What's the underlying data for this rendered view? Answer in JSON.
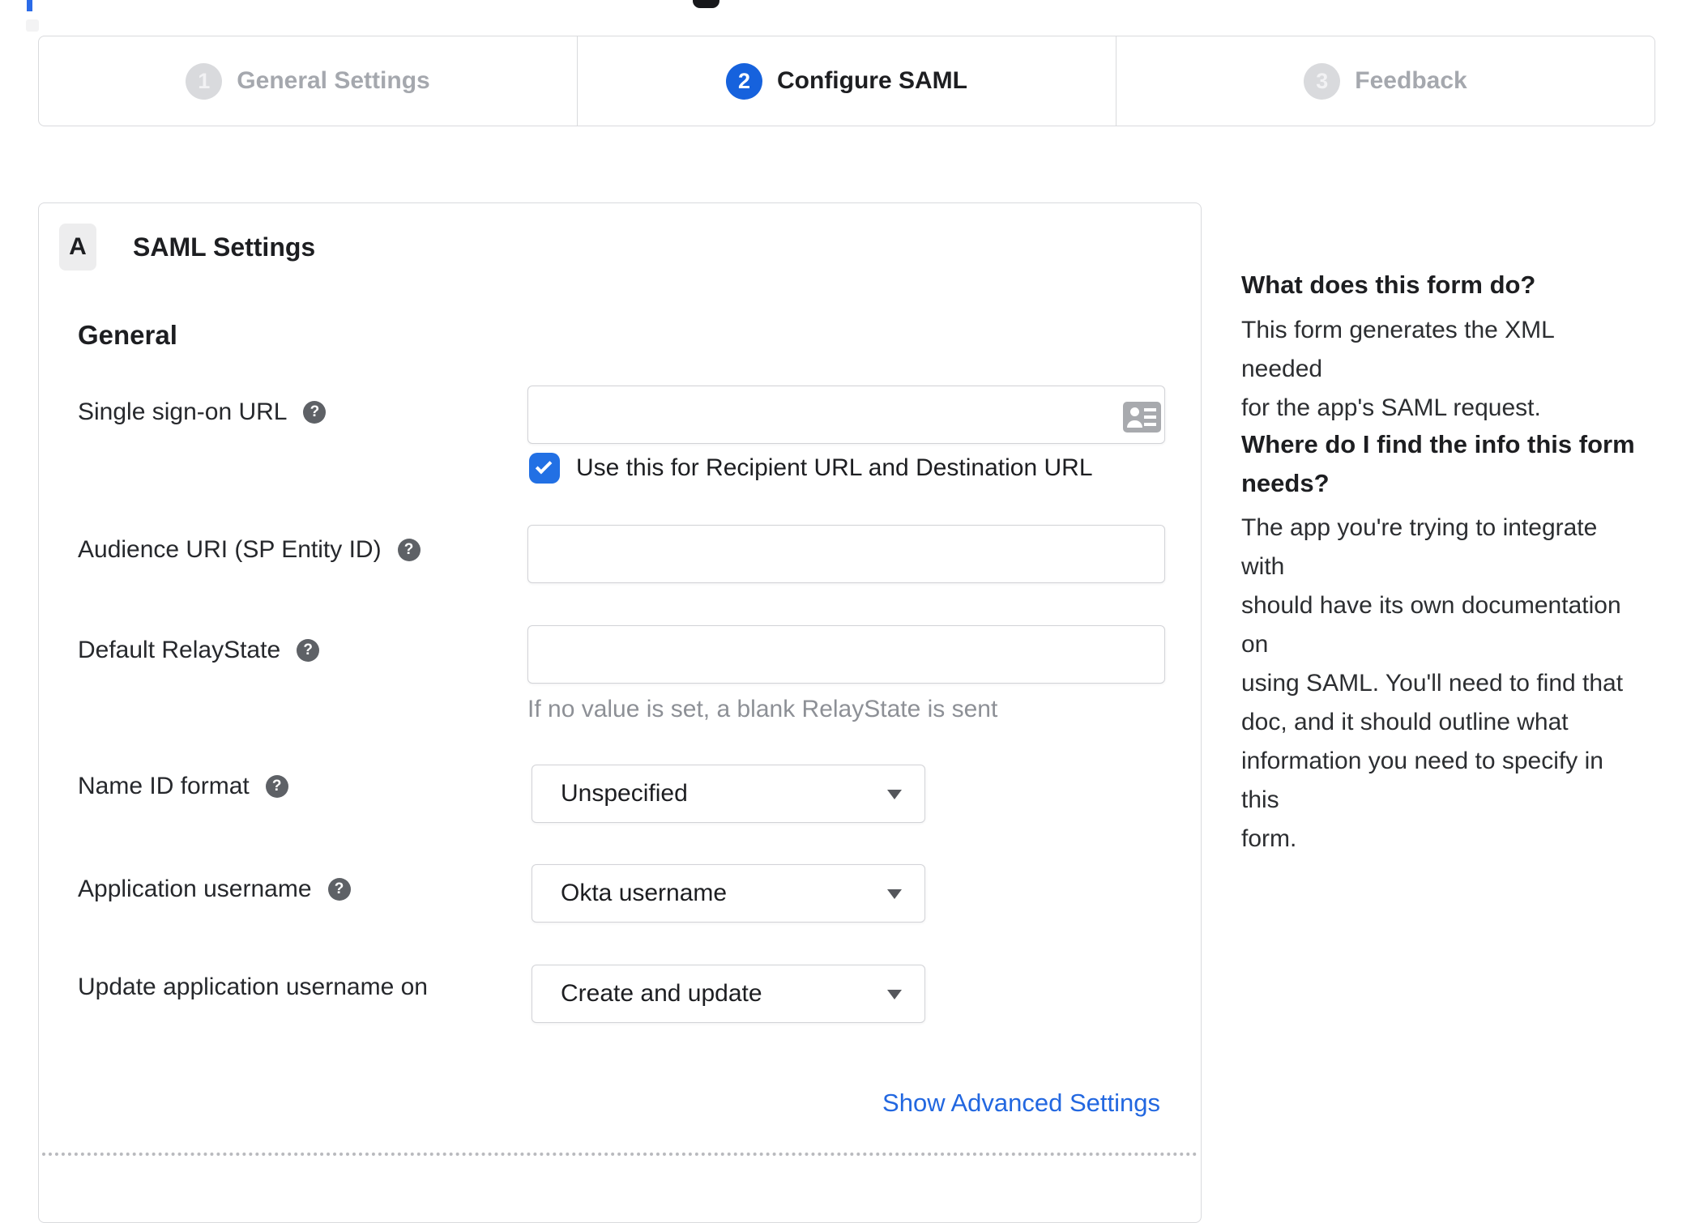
{
  "stepper": {
    "steps": [
      {
        "number": "1",
        "label": "General Settings",
        "state": "inactive"
      },
      {
        "number": "2",
        "label": "Configure SAML",
        "state": "active"
      },
      {
        "number": "3",
        "label": "Feedback",
        "state": "inactive"
      }
    ]
  },
  "panel": {
    "section_badge": "A",
    "section_title": "SAML Settings",
    "group_heading": "General",
    "fields": {
      "sso_url": {
        "label": "Single sign-on URL",
        "value": "",
        "checkbox_label": "Use this for Recipient URL and Destination URL",
        "checkbox_checked": true
      },
      "audience_uri": {
        "label": "Audience URI (SP Entity ID)",
        "value": ""
      },
      "default_relay_state": {
        "label": "Default RelayState",
        "value": "",
        "hint": "If no value is set, a blank RelayState is sent"
      },
      "name_id_format": {
        "label": "Name ID format",
        "value": "Unspecified"
      },
      "application_username": {
        "label": "Application username",
        "value": "Okta username"
      },
      "update_app_username_on": {
        "label": "Update application username on",
        "value": "Create and update"
      }
    },
    "advanced_link_label": "Show Advanced Settings"
  },
  "sidebar": {
    "sections": [
      {
        "heading": "What does this form do?",
        "body": "This form generates the XML needed\nfor the app's SAML request."
      },
      {
        "heading": "Where do I find the info this form\nneeds?",
        "body": "The app you're trying to integrate with\nshould have its own documentation on\nusing SAML. You'll need to find that\ndoc, and it should outline what\ninformation you need to specify in this\nform."
      }
    ]
  },
  "icons": {
    "help_glyph": "?"
  },
  "colors": {
    "active_step_blue": "#1662dd",
    "checkbox_blue": "#2270e4",
    "link_blue": "#2267e0",
    "border_gray": "#d9dadd",
    "inactive_gray": "#a5a8ae",
    "hint_gray": "#8d9096"
  }
}
